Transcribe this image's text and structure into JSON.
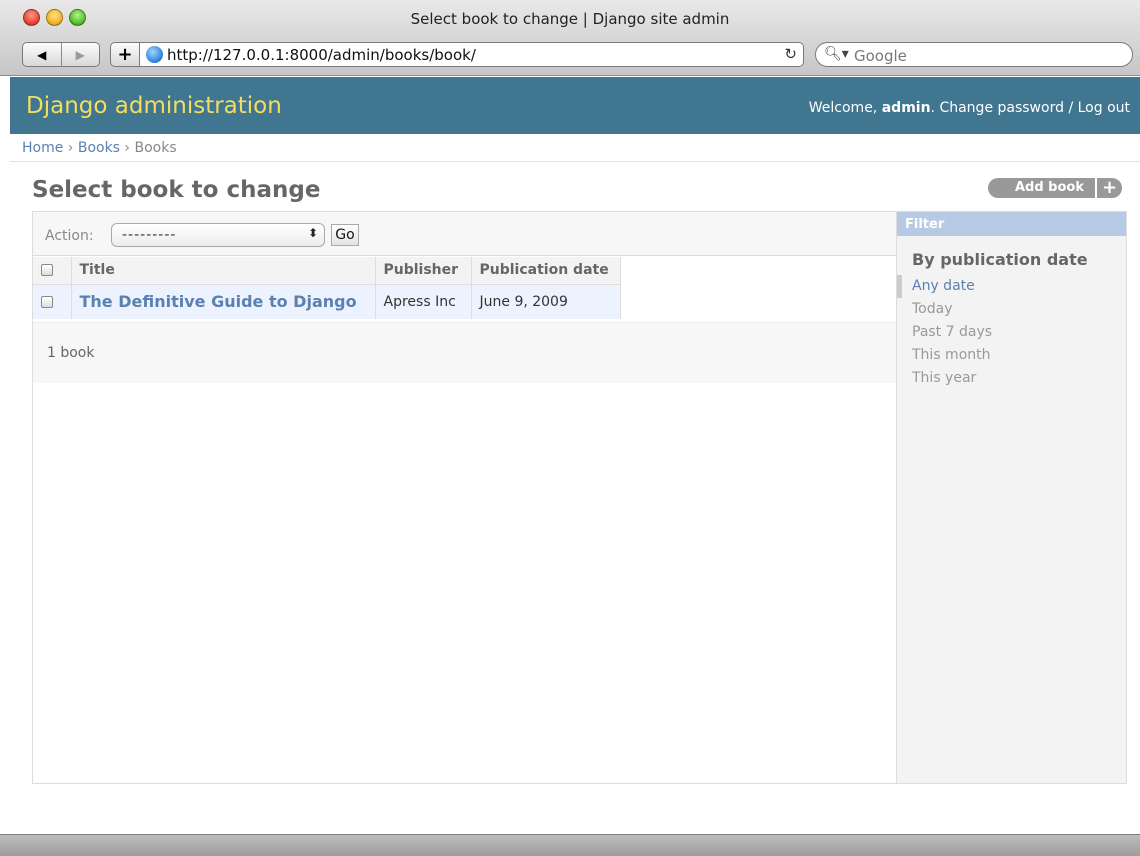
{
  "window": {
    "title": "Select book to change | Django site admin",
    "url": "http://127.0.0.1:8000/admin/books/book/",
    "search_placeholder": "Google"
  },
  "header": {
    "branding": "Django administration",
    "welcome": "Welcome,",
    "username": "admin",
    "change_password": "Change password",
    "separator": "/",
    "logout": "Log out"
  },
  "breadcrumbs": {
    "home": "Home",
    "app": "Books",
    "model": "Books"
  },
  "page": {
    "title": "Select book to change",
    "add_label": "Add book"
  },
  "actions": {
    "label": "Action:",
    "selected": "---------",
    "go": "Go"
  },
  "table": {
    "headers": [
      "Title",
      "Publisher",
      "Publication date"
    ],
    "rows": [
      {
        "title": "The Definitive Guide to Django",
        "publisher": "Apress Inc",
        "date": "June 9, 2009"
      }
    ]
  },
  "paginator": "1 book",
  "filter": {
    "heading": "Filter",
    "subheading": "By publication date",
    "options": [
      "Any date",
      "Today",
      "Past 7 days",
      "This month",
      "This year"
    ]
  },
  "colors": {
    "header_bg": "#417690",
    "branding": "#f5dd5d",
    "link": "#5b80b2"
  }
}
